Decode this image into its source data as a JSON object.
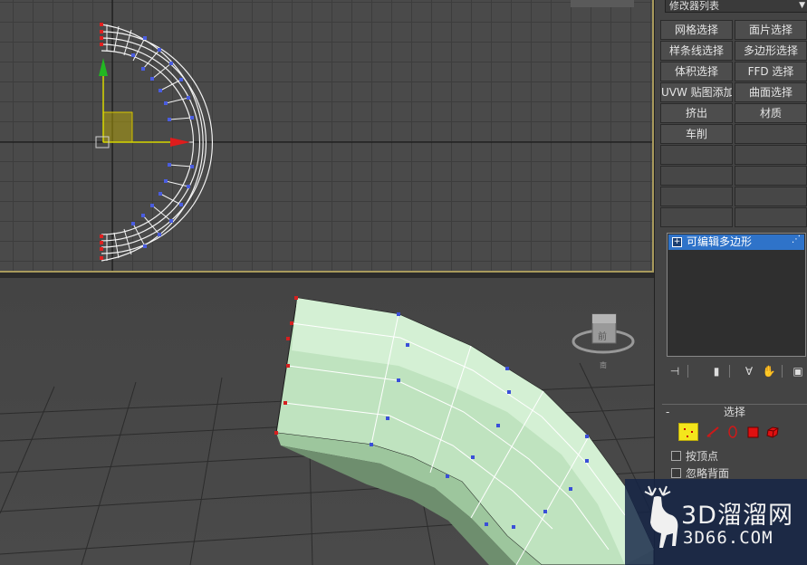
{
  "modifier_panel": {
    "dropdown_label": "修改器列表",
    "buttons": [
      "网格选择",
      "面片选择",
      "样条线选择",
      "多边形选择",
      "体积选择",
      "FFD 选择",
      "UVW 贴图添加",
      "曲面选择",
      "挤出",
      "材质",
      "车削",
      ""
    ],
    "stack": {
      "item_label": "可编辑多边形",
      "expand_symbol": "+"
    }
  },
  "selection_rollout": {
    "collapse_symbol": "-",
    "title": "选择",
    "checkboxes": [
      {
        "label": "按顶点",
        "checked": false
      },
      {
        "label": "忽略背面",
        "checked": false
      }
    ]
  },
  "viewports": {
    "top": {
      "active": true
    },
    "perspective": {
      "mesh_color": "#c8eac8",
      "vertex_color": "#3a4fd8",
      "edge_vertex_color": "#d42020"
    }
  },
  "watermark": {
    "line1": "3D溜溜网",
    "line2": "3D66.COM"
  },
  "colors": {
    "active_viewport_border": "#a89a5c",
    "stack_selection": "#2f73c9",
    "vertex_mode_icon": "#f4e61c"
  }
}
